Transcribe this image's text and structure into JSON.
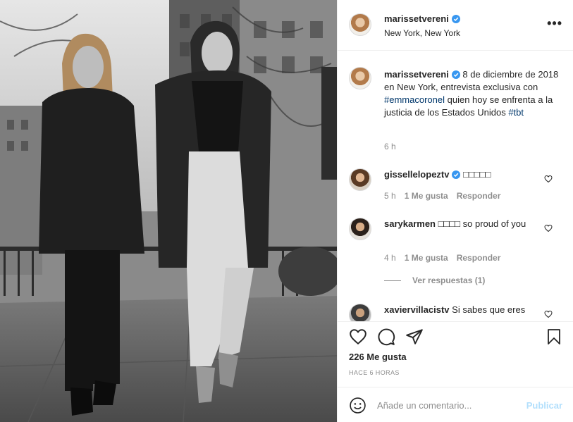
{
  "post": {
    "author": "marissetvereni",
    "location": "New York, New York",
    "more_label": "•••"
  },
  "caption": {
    "username": "marissetvereni",
    "text_before": " 8 de diciembre de 2018 en New York, entrevista exclusiva con ",
    "mention": "#emmacoronel",
    "text_after": " quien hoy se enfrenta a la justicia de los Estados Unidos ",
    "hashtag": "#tbt",
    "time": "6 h"
  },
  "comments": [
    {
      "username": "gissellelopeztv",
      "verified": true,
      "text": " □□□□□",
      "time": "5 h",
      "likes": "1 Me gusta",
      "reply_label": "Responder"
    },
    {
      "username": "sarykarmen",
      "verified": false,
      "text": " □□□□ so proud of you",
      "time": "4 h",
      "likes": "1 Me gusta",
      "reply_label": "Responder"
    },
    {
      "username": "xaviervillacistv",
      "verified": false,
      "text": " Si sabes que eres",
      "time": "",
      "likes": "",
      "reply_label": ""
    }
  ],
  "view_replies": "Ver respuestas (1)",
  "likes_text": "226 Me gusta",
  "posted_time": "HACE 6 HORAS",
  "comment_box": {
    "placeholder": "Añade un comentario...",
    "publish_label": "Publicar"
  },
  "colors": {
    "verified_blue": "#3897f0",
    "link_blue": "#00376b",
    "muted_text": "#8e8e8e",
    "publish_disabled": "#b2dffc"
  },
  "icons": [
    "verified-badge-icon",
    "more-options-icon",
    "heart-icon",
    "comment-icon",
    "share-icon",
    "bookmark-icon",
    "emoji-icon"
  ]
}
